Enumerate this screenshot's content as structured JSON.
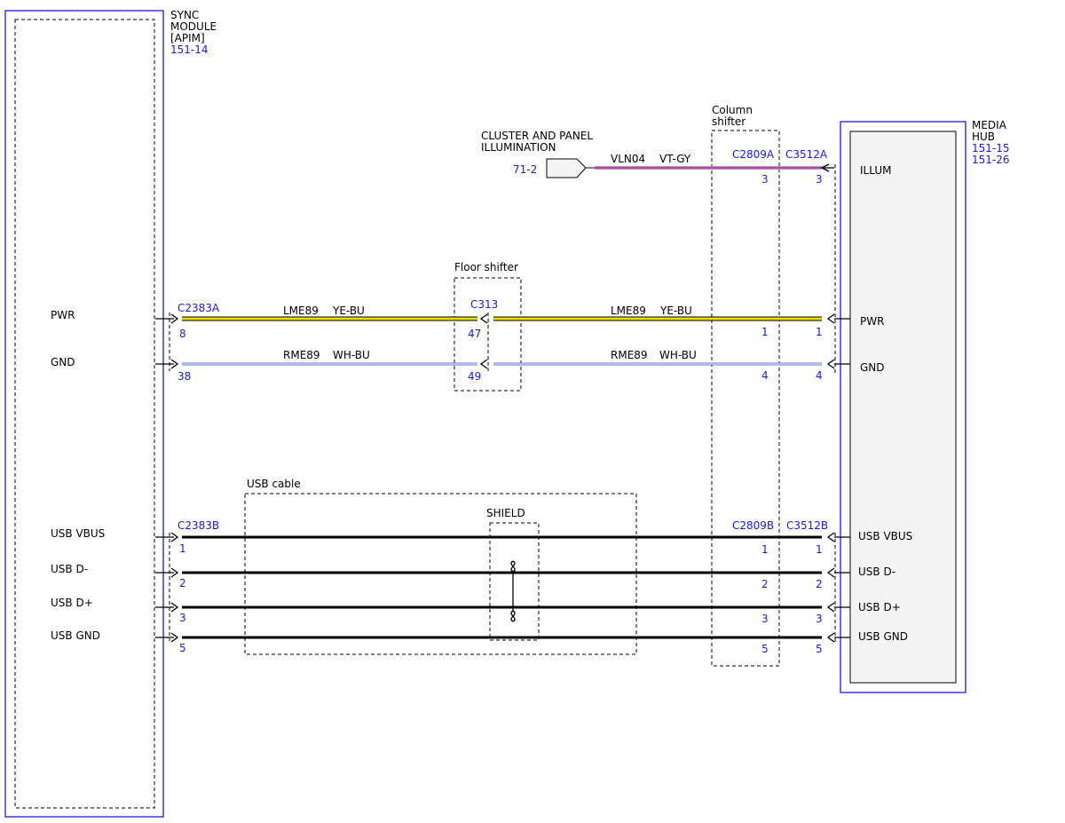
{
  "left_module": {
    "name_lines": [
      "SYNC",
      "MODULE",
      "[APIM]"
    ],
    "ref": "151-14",
    "pins": [
      "PWR",
      "GND",
      "USB VBUS",
      "USB D-",
      "USB D+",
      "USB GND"
    ]
  },
  "right_module": {
    "name_lines": [
      "MEDIA",
      "HUB"
    ],
    "refs": [
      "151-15",
      "151-26"
    ],
    "pins": [
      "ILLUM",
      "PWR",
      "GND",
      "USB VBUS",
      "USB D-",
      "USB D+",
      "USB GND"
    ]
  },
  "illumination": {
    "label_lines": [
      "CLUSTER AND PANEL",
      "ILLUMINATION"
    ],
    "ref": "71-2",
    "circuit": "VLN04",
    "color": "VT-GY"
  },
  "floor_shifter": {
    "label": "Floor shifter",
    "connector": "C313",
    "pins": [
      "47",
      "49"
    ]
  },
  "column_shifter": {
    "label_lines": [
      "Column",
      "shifter"
    ]
  },
  "connectors": {
    "c2383a": {
      "name": "C2383A",
      "pins": [
        "8",
        "38"
      ]
    },
    "c2383b": {
      "name": "C2383B",
      "pins": [
        "1",
        "2",
        "3",
        "5"
      ]
    },
    "c2809a": {
      "name": "C2809A",
      "pins": [
        "3",
        "1",
        "4"
      ]
    },
    "c2809b": {
      "name": "C2809B",
      "pins": [
        "1",
        "2",
        "3",
        "5"
      ]
    },
    "c3512a": {
      "name": "C3512A",
      "pins": [
        "3",
        "1",
        "4"
      ]
    },
    "c3512b": {
      "name": "C3512B",
      "pins": [
        "1",
        "2",
        "3",
        "5"
      ]
    }
  },
  "wires": {
    "pwr_left": {
      "circuit": "LME89",
      "color": "YE-BU"
    },
    "pwr_right": {
      "circuit": "LME89",
      "color": "YE-BU"
    },
    "gnd_left": {
      "circuit": "RME89",
      "color": "WH-BU"
    },
    "gnd_right": {
      "circuit": "RME89",
      "color": "WH-BU"
    }
  },
  "usb_cable": {
    "label": "USB cable",
    "shield_label": "SHIELD"
  },
  "colors": {
    "module_border": "#1a1adb",
    "label_blue": "#1a1adb",
    "yellow": "#e8e000",
    "violet": "#c040c0",
    "gray": "#a0a0a0",
    "wh_blue": "#5a7ae0"
  }
}
